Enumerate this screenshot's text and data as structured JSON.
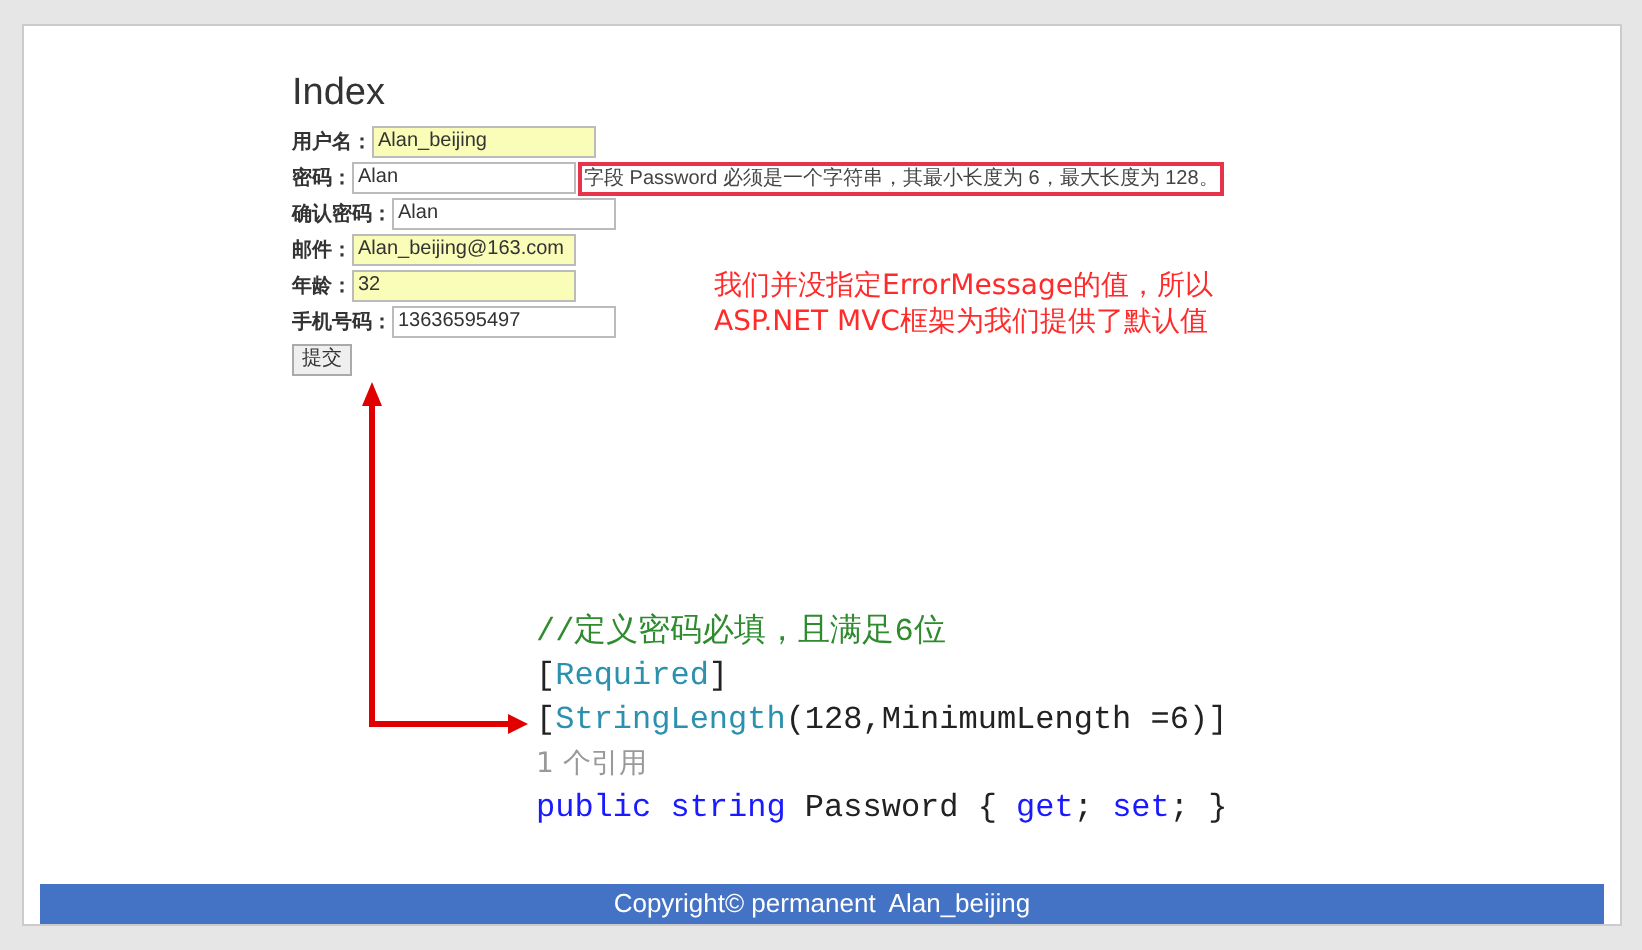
{
  "page": {
    "title": "Index"
  },
  "form": {
    "fields": [
      {
        "label": "用户名：",
        "value": "Alan_beijing",
        "autofilled": true
      },
      {
        "label": "密码：",
        "value": "Alan",
        "autofilled": false,
        "error": "字段 Password 必须是一个字符串，其最小长度为 6，最大长度为 128。"
      },
      {
        "label": "确认密码：",
        "value": "Alan",
        "autofilled": false
      },
      {
        "label": "邮件：",
        "value": "Alan_beijing@163.com",
        "autofilled": true
      },
      {
        "label": "年龄：",
        "value": "32",
        "autofilled": true
      },
      {
        "label": "手机号码：",
        "value": "13636595497",
        "autofilled": false
      }
    ],
    "submit": "提交"
  },
  "annotation": [
    "我们并没指定ErrorMessage的值，所以",
    "ASP.NET MVC框架为我们提供了默认值"
  ],
  "code": [
    [
      {
        "kind": "comment",
        "text": "//定义密码必填，且满足6位"
      }
    ],
    [
      {
        "kind": "plain",
        "text": "["
      },
      {
        "kind": "type",
        "text": "Required"
      },
      {
        "kind": "plain",
        "text": "]"
      }
    ],
    [
      {
        "kind": "plain",
        "text": "["
      },
      {
        "kind": "type",
        "text": "StringLength"
      },
      {
        "kind": "plain",
        "text": "(128,MinimumLength =6)]"
      }
    ],
    [
      {
        "kind": "lens",
        "text": "1 个引用"
      }
    ],
    [
      {
        "kind": "keyword",
        "text": "public string"
      },
      {
        "kind": "plain",
        "text": " Password { "
      },
      {
        "kind": "keyword",
        "text": "get"
      },
      {
        "kind": "plain",
        "text": "; "
      },
      {
        "kind": "keyword",
        "text": "set"
      },
      {
        "kind": "plain",
        "text": "; }"
      }
    ]
  ],
  "footer": "Copyright© permanent  Alan_beijing"
}
